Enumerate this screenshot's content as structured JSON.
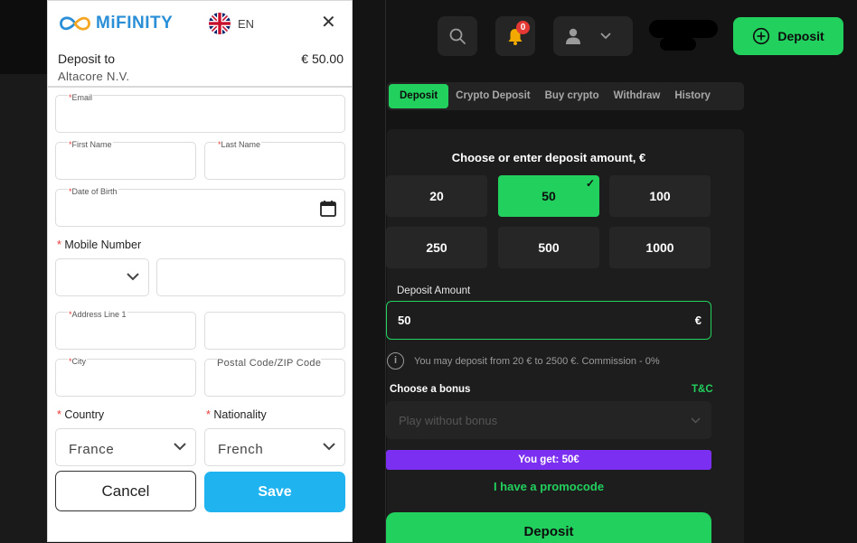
{
  "modal": {
    "brand": "MiFINITY",
    "language": "EN",
    "deposit_to_label": "Deposit to",
    "deposit_amount": "€ 50.00",
    "merchant": "Altacore N.V.",
    "fields": {
      "email": "Email",
      "first_name": "First Name",
      "last_name": "Last Name",
      "dob": "Date of Birth",
      "mobile_number": "Mobile Number",
      "address_line_1": "Address Line 1",
      "city": "City",
      "postal_code": "Postal Code/ZIP Code",
      "country": "Country",
      "nationality": "Nationality"
    },
    "required_mark": "*",
    "country_value": "France",
    "nationality_value": "French",
    "cancel_label": "Cancel",
    "save_label": "Save"
  },
  "header": {
    "notification_count": "0",
    "deposit_label": "Deposit"
  },
  "tabs": [
    "Deposit",
    "Crypto Deposit",
    "Buy crypto",
    "Withdraw",
    "History"
  ],
  "active_tab": 0,
  "deposit_panel": {
    "choose_title": "Choose or enter deposit amount, €",
    "amounts": [
      "20",
      "50",
      "100",
      "250",
      "500",
      "1000"
    ],
    "selected_amount": "50",
    "amount_label": "Deposit Amount",
    "amount_value": "50",
    "currency_symbol": "€",
    "info_text": "You may deposit from 20 € to 2500 €. Commission - 0%",
    "bonus_label": "Choose a bonus",
    "tnc_label": "T&C",
    "bonus_placeholder": "Play without bonus",
    "you_get": "You get: 50€",
    "promo_label": "I have a promocode",
    "deposit_button": "Deposit"
  },
  "colors": {
    "accent_green": "#22d05e",
    "bonus_purple": "#7b2ff0",
    "save_blue": "#1fb3f0",
    "brand_blue": "#2a8fd6",
    "required_red": "#e53935"
  }
}
